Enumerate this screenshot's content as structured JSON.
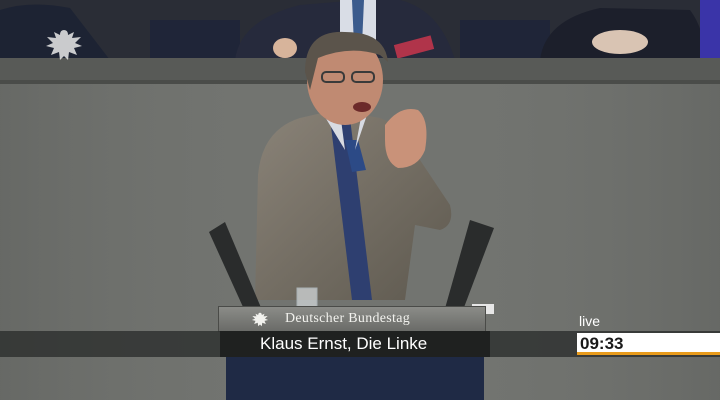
{
  "broadcast": {
    "institution": "Deutscher Bundestag",
    "speaker_caption": "Klaus Ernst, Die Linke",
    "live_label": "live",
    "clock": "09:33",
    "accent_color": "#e89b1c"
  },
  "icons": {
    "corner_logo": "federal-eagle-icon",
    "plate_logo": "federal-eagle-icon"
  }
}
